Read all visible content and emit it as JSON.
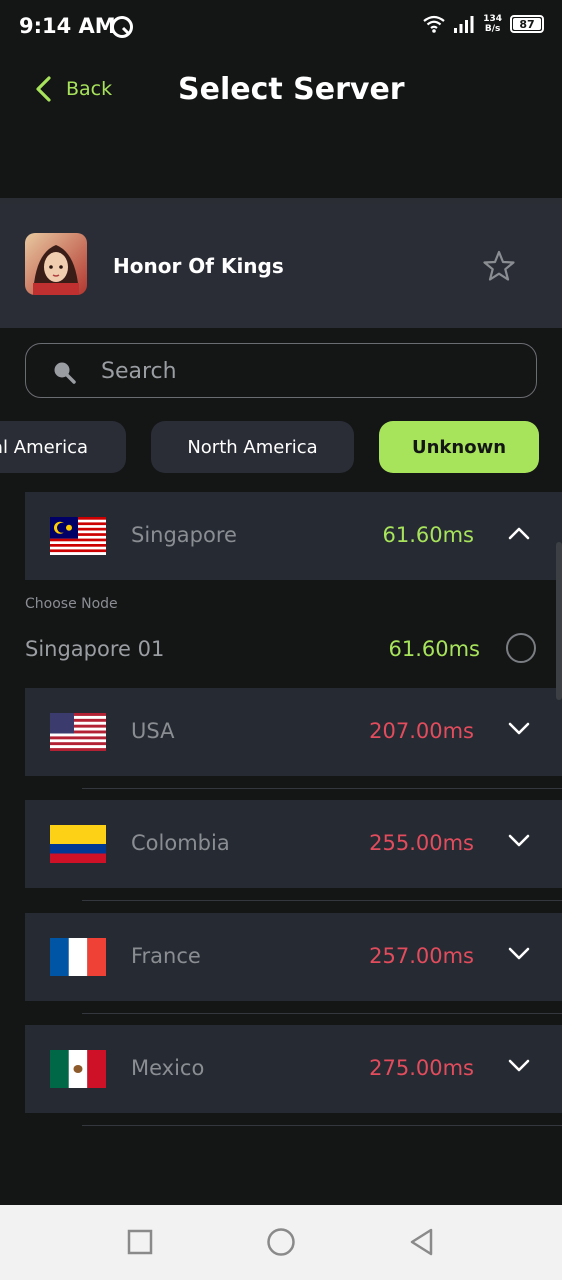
{
  "status_bar": {
    "time": "9:14 AM",
    "net_speed_value": "134",
    "net_speed_unit": "B/s",
    "battery": "87"
  },
  "header": {
    "back_label": "Back",
    "title": "Select Server"
  },
  "game": {
    "name": "Honor Of Kings"
  },
  "search": {
    "placeholder": "Search"
  },
  "region_chips": [
    {
      "label": "al America",
      "selected": false
    },
    {
      "label": "North America",
      "selected": false
    },
    {
      "label": "Unknown",
      "selected": true
    }
  ],
  "servers": [
    {
      "country": "Singapore",
      "ping": "61.60ms",
      "expanded": true,
      "flag": "malaysia-style-flag"
    },
    {
      "country": "USA",
      "ping": "207.00ms",
      "expanded": false,
      "flag": "usa-flag"
    },
    {
      "country": "Colombia",
      "ping": "255.00ms",
      "expanded": false,
      "flag": "colombia-flag"
    },
    {
      "country": "France",
      "ping": "257.00ms",
      "expanded": false,
      "flag": "france-flag"
    },
    {
      "country": "Mexico",
      "ping": "275.00ms",
      "expanded": false,
      "flag": "mexico-flag"
    }
  ],
  "node_section": {
    "label": "Choose Node",
    "nodes": [
      {
        "name": "Singapore 01",
        "ping": "61.60ms",
        "selected": false
      }
    ]
  },
  "colors": {
    "accent": "#a7e35b",
    "ping_good": "#a7e35b",
    "ping_bad": "#e24c5c",
    "background": "#141515",
    "card": "#262a33"
  }
}
